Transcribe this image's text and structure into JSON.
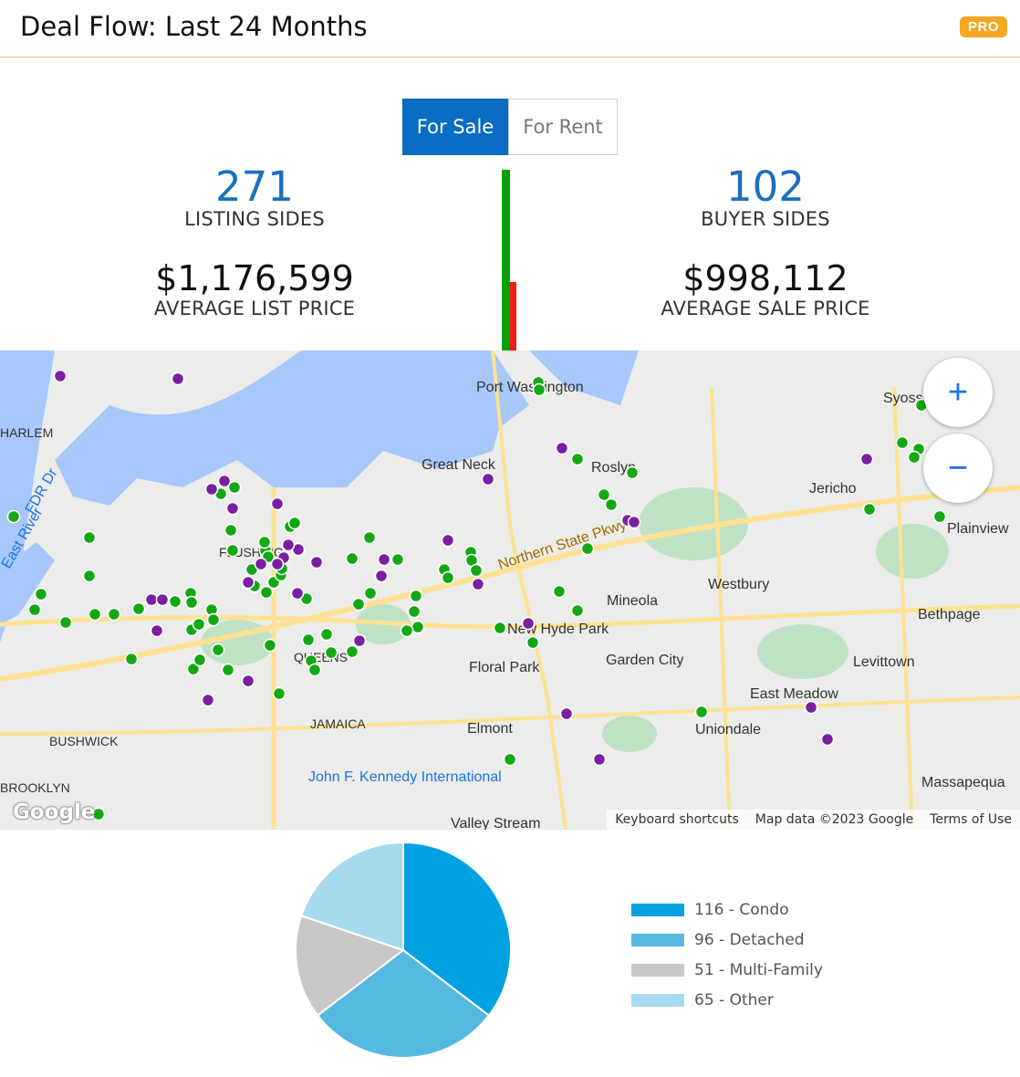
{
  "header": {
    "title": "Deal Flow: Last 24 Months",
    "badge": "PRO"
  },
  "toggle": {
    "for_sale": "For Sale",
    "for_rent": "For Rent",
    "selected": "For Sale"
  },
  "stats": {
    "listing_sides": {
      "value": "271",
      "label": "LISTING SIDES"
    },
    "buyer_sides": {
      "value": "102",
      "label": "BUYER SIDES"
    },
    "avg_list_price": {
      "value": "$1,176,599",
      "label": "AVERAGE LIST PRICE"
    },
    "avg_sale_price": {
      "value": "$998,112",
      "label": "AVERAGE SALE PRICE"
    }
  },
  "sides_bars": [
    {
      "name": "Listing sides",
      "value": 271,
      "color": "#0a9e0a"
    },
    {
      "name": "Buyer sides",
      "value": 102,
      "color": "#ef1c1c"
    }
  ],
  "map": {
    "zoom_in": "+",
    "zoom_out": "−",
    "attribution_logo": "Google",
    "footer": {
      "shortcuts": "Keyboard shortcuts",
      "map_data": "Map data ©2023 Google",
      "terms": "Terms of Use"
    },
    "labels": [
      "HARLEM",
      "Port Washington",
      "Great Neck",
      "Roslyn",
      "Jericho",
      "Syosset",
      "Plainview",
      "Westbury",
      "Mineola",
      "New Hyde Park",
      "Floral Park",
      "Garden City",
      "Levittown",
      "Bethpage",
      "East Meadow",
      "Uniondale",
      "Elmont",
      "Massapequa",
      "QUEENS",
      "JAMAICA",
      "BUSHWICK",
      "BROOKLYN",
      "FLUSHING",
      "John F. Kennedy International",
      "Valley Stream",
      "Northern State Pkwy",
      "East River",
      "FDR Dr"
    ],
    "marker_colors": {
      "listing": "#13a813",
      "buyer": "#7b1fa2"
    }
  },
  "chart_data": {
    "type": "pie",
    "categories": [
      "Condo",
      "Detached",
      "Multi-Family",
      "Other"
    ],
    "values": [
      116,
      96,
      51,
      65
    ],
    "colors": [
      "#00a1e0",
      "#55b8e0",
      "#c8c8c8",
      "#a8daef"
    ],
    "legend": [
      "116 - Condo",
      "96 - Detached",
      "51 - Multi-Family",
      "65 - Other"
    ],
    "legend_position": "right"
  }
}
